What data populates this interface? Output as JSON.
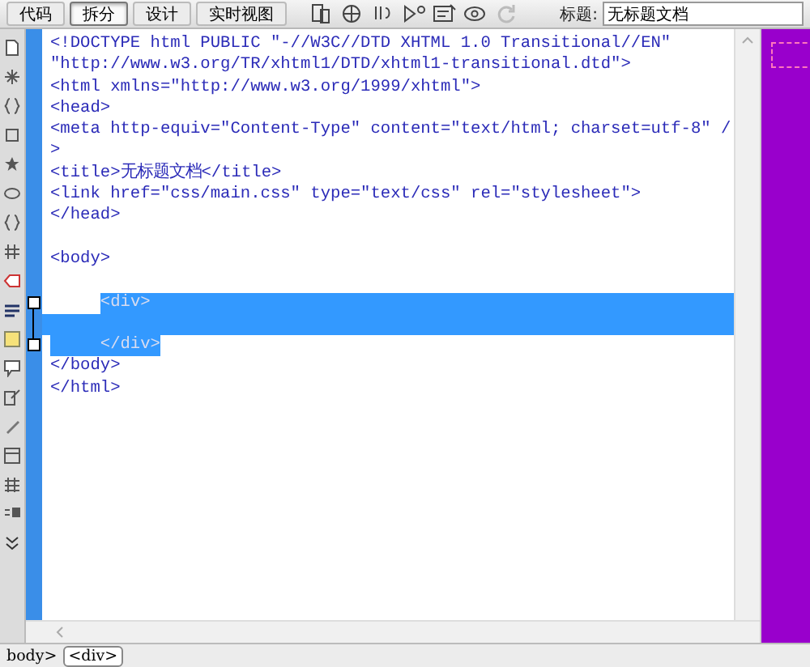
{
  "toolbar": {
    "view_buttons": [
      {
        "label": "代码",
        "selected": false
      },
      {
        "label": "拆分",
        "selected": true
      },
      {
        "label": "设计",
        "selected": false
      },
      {
        "label": "实时视图",
        "selected": false
      }
    ],
    "title_label": "标题:",
    "title_value": "无标题文档"
  },
  "code_lines": [
    {
      "kind": "code",
      "text": "<!DOCTYPE html PUBLIC \"-//W3C//DTD XHTML 1.0 Transitional//EN\"",
      "selected": false
    },
    {
      "kind": "code",
      "text": "\"http://www.w3.org/TR/xhtml1/DTD/xhtml1-transitional.dtd\">",
      "selected": false
    },
    {
      "kind": "code",
      "text": "<html xmlns=\"http://www.w3.org/1999/xhtml\">",
      "selected": false
    },
    {
      "kind": "code",
      "text": "<head>",
      "selected": false
    },
    {
      "kind": "code",
      "text": "<meta http-equiv=\"Content-Type\" content=\"text/html; charset=utf-8\" /",
      "selected": false
    },
    {
      "kind": "code",
      "text": ">",
      "selected": false
    },
    {
      "kind": "code",
      "text": "<title>无标题文档</title>",
      "selected": false
    },
    {
      "kind": "code",
      "text": "<link href=\"css/main.css\" type=\"text/css\" rel=\"stylesheet\">",
      "selected": false
    },
    {
      "kind": "code",
      "text": "</head>",
      "selected": false
    },
    {
      "kind": "blank"
    },
    {
      "kind": "code",
      "text": "<body>",
      "selected": false
    },
    {
      "kind": "blank"
    },
    {
      "kind": "code",
      "text": "     <div>",
      "selected": true,
      "fold_marker": true
    },
    {
      "kind": "blank",
      "selected": true
    },
    {
      "kind": "code",
      "text": "     </div>",
      "selected": true,
      "fold_marker": true
    },
    {
      "kind": "code",
      "text": "</body>",
      "selected": false
    },
    {
      "kind": "code",
      "text": "</html>",
      "selected": false
    }
  ],
  "status_bar": {
    "tags": [
      {
        "label": "body>",
        "selected": false
      },
      {
        "label": "<div>",
        "selected": true
      }
    ]
  }
}
